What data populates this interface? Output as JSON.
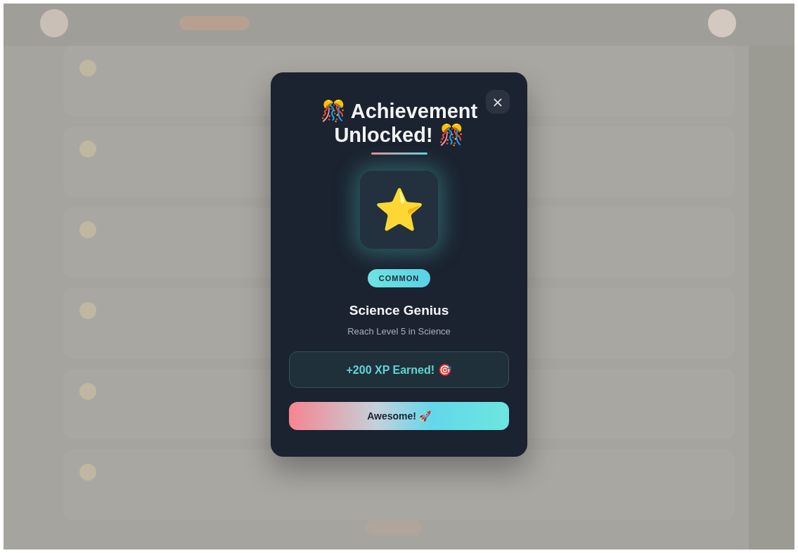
{
  "modal": {
    "title": "🎊 Achievement Unlocked! 🎊",
    "close": "×",
    "badge_icon": "⭐",
    "rarity": "COMMON",
    "name": "Science Genius",
    "description": "Reach Level 5 in Science",
    "reward": "+200 XP Earned! 🎯",
    "button": "Awesome! 🚀"
  }
}
